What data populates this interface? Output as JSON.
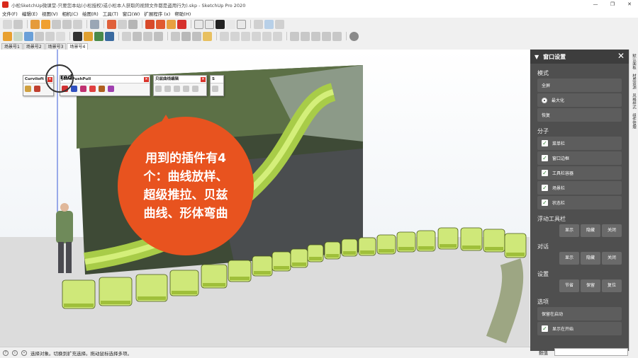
{
  "window": {
    "title": "小松SketchUp微课堂-只要您本站(小松授权)或小松本人获取的视频文件都是盗用行为).skp - SketchUp Pro 2020",
    "controls": [
      "—",
      "❐",
      "✕"
    ]
  },
  "menu": [
    "文件(F)",
    "编辑(E)",
    "视图(V)",
    "相机(C)",
    "绘图(R)",
    "工具(T)",
    "窗口(W)",
    "扩展程序 (x)",
    "帮助(H)"
  ],
  "scene_tabs": [
    {
      "label": "场景号1",
      "active": false
    },
    {
      "label": "场景号2",
      "active": false
    },
    {
      "label": "场景号3",
      "active": false
    },
    {
      "label": "场景号4",
      "active": true
    }
  ],
  "floating_toolbars": [
    {
      "title": "Curviloft",
      "icons": 2
    },
    {
      "title": "JointPushPull",
      "icons": 6
    },
    {
      "title": "贝兹曲线编辑",
      "icons": 5
    },
    {
      "title": "S",
      "icons": 1
    }
  ],
  "magnifier_text": "red",
  "callout": {
    "lines": [
      "用到的插件有4",
      "个：曲线放样、",
      "超级推拉、贝兹",
      "曲线、形体弯曲"
    ],
    "color": "#e8531f"
  },
  "panel": {
    "title": "窗口设置",
    "mode_label": "模式",
    "modes": [
      {
        "label": "全屏",
        "selected": false
      },
      {
        "label": "最大化",
        "selected": true
      },
      {
        "label": "恢复",
        "selected": false
      }
    ],
    "components_label": "分子",
    "components": [
      "菜单栏",
      "窗口边框",
      "工具栏容器",
      "场景栏",
      "状态栏"
    ],
    "float_label": "浮动工具栏",
    "float_btns": [
      "显示",
      "隐藏",
      "关闭"
    ],
    "dialog_label": "对话",
    "dialog_btns": [
      "显示",
      "隐藏",
      "关闭"
    ],
    "settings_label": "设置",
    "settings_btns": [
      "节省",
      "保留",
      "复位"
    ],
    "options_label": "选项",
    "options": [
      {
        "label": "保留在启动",
        "checked": false
      },
      {
        "label": "显示在开始",
        "checked": true
      }
    ]
  },
  "tray_tabs": [
    "默认面板",
    "材质资源",
    "风格样式",
    "组件管理"
  ],
  "status": {
    "text": "选择对象。切换到扩充选择。拖动鼠标选择多项。",
    "measure_label": "数值"
  },
  "colors": {
    "accent": "#e8531f",
    "panel_bg": "#4f4f4f",
    "segment_green": "#cfe879"
  }
}
